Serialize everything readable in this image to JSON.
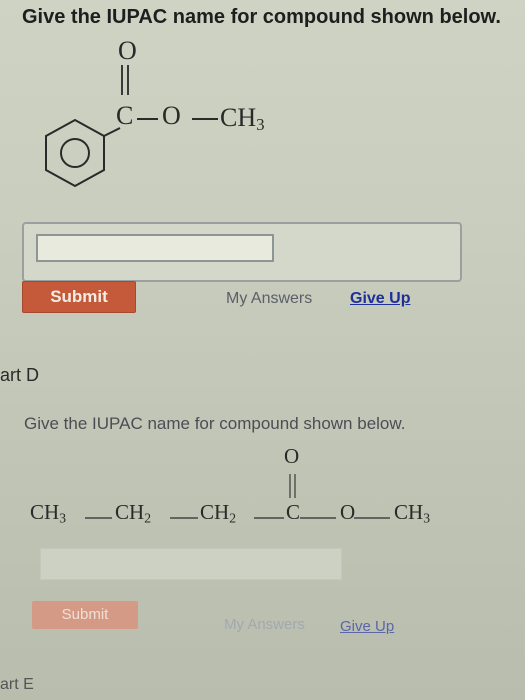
{
  "part_c": {
    "question": "Give the IUPAC name for compound shown below.",
    "structure": {
      "top_o": "O",
      "c": "C",
      "o": "O",
      "ch3": "CH3"
    },
    "answer": {
      "value": "",
      "placeholder": ""
    },
    "submit_label": "Submit",
    "my_answers_label": "My Answers",
    "give_up_label": "Give Up"
  },
  "part_d": {
    "label": "art D",
    "question": "Give the IUPAC name for compound shown below.",
    "structure": {
      "ch3_left": "CH3",
      "ch2_1": "CH2",
      "ch2_2": "CH2",
      "top_o": "O",
      "c": "C",
      "o": "O",
      "ch3_right": "CH3"
    },
    "submit_label": "Submit",
    "my_answers_label": "My Answers",
    "give_up_label": "Give Up"
  },
  "part_e": {
    "label": "art E"
  },
  "colors": {
    "submit_active": "#c45a3a",
    "submit_disabled": "#d59a86",
    "link": "#1d2f9a",
    "background": "#c9cdbd"
  }
}
